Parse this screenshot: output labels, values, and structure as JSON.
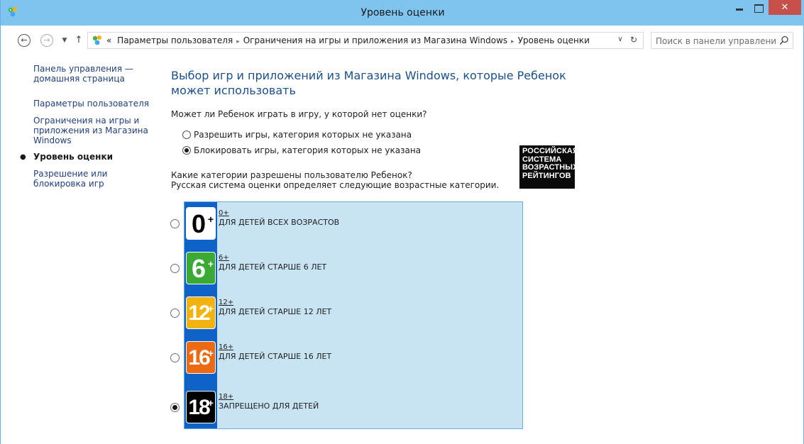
{
  "window": {
    "title": "Уровень оценки",
    "close_glyph": "✕"
  },
  "address": {
    "prefix": "«",
    "crumbs": [
      "Параметры пользователя",
      "Ограничения на игры и приложения из Магазина Windows",
      "Уровень оценки"
    ],
    "search_placeholder": "Поиск в панели управления"
  },
  "sidebar": {
    "items": [
      {
        "label": "Панель управления — домашняя страница"
      },
      {
        "label": "Параметры пользователя"
      },
      {
        "label": "Ограничения на игры и приложения из Магазина Windows"
      },
      {
        "label": "Уровень оценки",
        "current": true
      },
      {
        "label": "Разрешение или блокировка игр"
      }
    ]
  },
  "main": {
    "title": "Выбор игр и приложений из Магазина Windows, которые Ребенок может использовать",
    "question_unrated": "Может ли Ребенок играть в игру, у которой нет оценки?",
    "options_unrated": [
      {
        "label": "Разрешить игры, категория которых не указана",
        "checked": false
      },
      {
        "label": "Блокировать игры, категория которых не указана",
        "checked": true
      }
    ],
    "question_categories": "Какие категории разрешены пользователю Ребенок?",
    "question_categories_note": "Русская система оценки определяет следующие возрастные категории.",
    "rating_system_logo": [
      "РОССИЙСКАЯ",
      "СИСТЕМА",
      "ВОЗРАСТНЫХ",
      "РЕЙТИНГОВ"
    ]
  },
  "ratings": [
    {
      "badge_number": "0",
      "code": "0+",
      "description": "ДЛЯ ДЕТЕЙ ВСЕХ ВОЗРАСТОВ",
      "checked": false,
      "badge_bg": "#ffffff",
      "badge_fg": "#000000"
    },
    {
      "badge_number": "6",
      "code": "6+",
      "description": "ДЛЯ ДЕТЕЙ СТАРШЕ 6 ЛЕТ",
      "checked": false,
      "badge_bg": "#3aaa35",
      "badge_fg": "#ffffff"
    },
    {
      "badge_number": "12",
      "code": "12+",
      "description": "ДЛЯ ДЕТЕЙ СТАРШЕ 12 ЛЕТ",
      "checked": false,
      "badge_bg": "#f2b20f",
      "badge_fg": "#ffffff"
    },
    {
      "badge_number": "16",
      "code": "16+",
      "description": "ДЛЯ ДЕТЕЙ СТАРШЕ 16 ЛЕТ",
      "checked": false,
      "badge_bg": "#ec6a12",
      "badge_fg": "#ffffff"
    },
    {
      "badge_number": "18",
      "code": "18+",
      "description": "ЗАПРЕЩЕНО ДЛЯ ДЕТЕЙ",
      "checked": true,
      "badge_bg": "#000000",
      "badge_fg": "#ffffff"
    }
  ],
  "theme": {
    "titlebar": "#7ec4ef",
    "link": "#1f3f7f",
    "heading": "#1c4f8a",
    "panel_bg": "#c8e4f3",
    "strip": "#0f62c8",
    "close_btn": "#c7504b"
  }
}
